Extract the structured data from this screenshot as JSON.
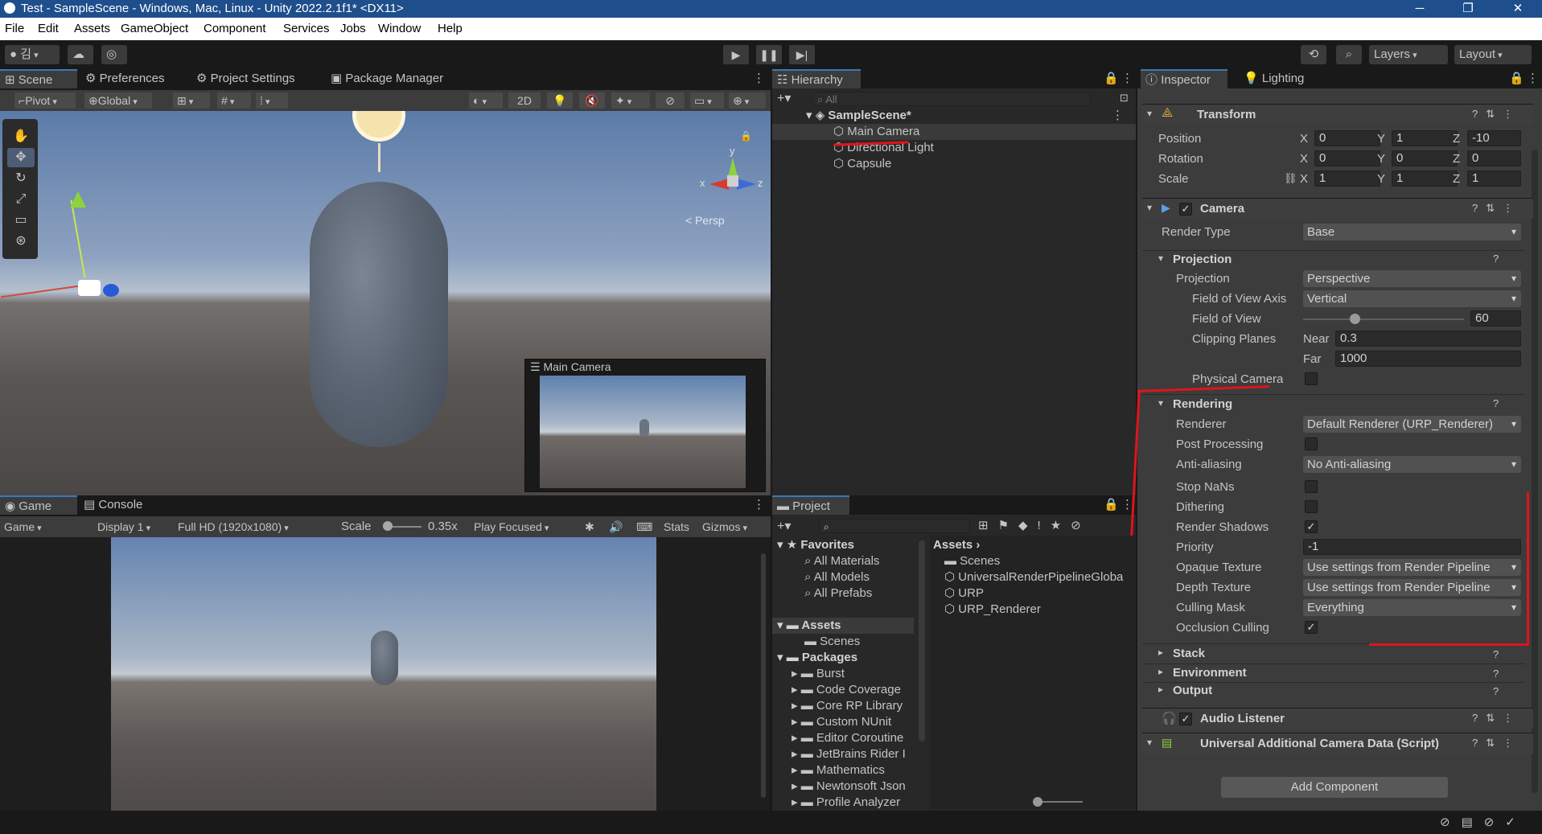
{
  "window": {
    "title": "Test - SampleScene - Windows, Mac, Linux - Unity 2022.2.1f1* <DX11>",
    "minimize": "─",
    "maximize": "❐",
    "close": "✕"
  },
  "menu": [
    "File",
    "Edit",
    "Assets",
    "GameObject",
    "Component",
    "Services",
    "Jobs",
    "Window",
    "Help"
  ],
  "toolbar": {
    "account": "김",
    "layers": "Layers",
    "layout": "Layout"
  },
  "scene_tabs": [
    "Scene",
    "Preferences",
    "Project Settings",
    "Package Manager"
  ],
  "scene_toolbar": {
    "pivot": "Pivot",
    "global": "Global",
    "mode2d": "2D"
  },
  "scene": {
    "persp": "< Persp",
    "gizmo_x": "x",
    "gizmo_y": "y",
    "gizmo_z": "z",
    "preview_title": "Main Camera"
  },
  "game_tabs": [
    "Game",
    "Console"
  ],
  "game_toolbar": {
    "mode": "Game",
    "display": "Display 1",
    "resolution": "Full HD (1920x1080)",
    "scale_label": "Scale",
    "scale_value": "0.35x",
    "play_focused": "Play Focused",
    "stats": "Stats",
    "gizmos": "Gizmos"
  },
  "hierarchy": {
    "tab": "Hierarchy",
    "search_placeholder": "All",
    "scene": "SampleScene*",
    "items": [
      "Main Camera",
      "Directional Light",
      "Capsule"
    ]
  },
  "project": {
    "tab": "Project",
    "favorites": "Favorites",
    "favorite_items": [
      "All Materials",
      "All Models",
      "All Prefabs"
    ],
    "assets": "Assets",
    "asset_children": [
      "Scenes"
    ],
    "packages": "Packages",
    "package_items": [
      "Burst",
      "Code Coverage",
      "Core RP Library",
      "Custom NUnit",
      "Editor Coroutine",
      "JetBrains Rider I",
      "Mathematics",
      "Newtonsoft Json",
      "Profile Analyzer"
    ],
    "breadcrumb": "Assets",
    "files": [
      "Scenes",
      "UniversalRenderPipelineGloba",
      "URP",
      "URP_Renderer"
    ]
  },
  "inspector": {
    "tabs": [
      "Inspector",
      "Lighting"
    ],
    "transform": {
      "title": "Transform",
      "rows": [
        {
          "label": "Position",
          "x": "0",
          "y": "1",
          "z": "-10"
        },
        {
          "label": "Rotation",
          "x": "0",
          "y": "0",
          "z": "0"
        },
        {
          "label": "Scale",
          "x": "1",
          "y": "1",
          "z": "1"
        }
      ]
    },
    "camera": {
      "title": "Camera",
      "render_type_label": "Render Type",
      "render_type": "Base",
      "projection_section": "Projection",
      "projection_label": "Projection",
      "projection": "Perspective",
      "fov_axis_label": "Field of View Axis",
      "fov_axis": "Vertical",
      "fov_label": "Field of View",
      "fov": "60",
      "fov_fraction": 0.32,
      "clipping_label": "Clipping Planes",
      "near_label": "Near",
      "near": "0.3",
      "far_label": "Far",
      "far": "1000",
      "physical_label": "Physical Camera",
      "rendering_section": "Rendering",
      "renderer_label": "Renderer",
      "renderer": "Default Renderer (URP_Renderer)",
      "post_label": "Post Processing",
      "aa_label": "Anti-aliasing",
      "aa": "No Anti-aliasing",
      "stopnans_label": "Stop NaNs",
      "dither_label": "Dithering",
      "shadows_label": "Render Shadows",
      "priority_label": "Priority",
      "priority": "-1",
      "opaque_label": "Opaque Texture",
      "opaque": "Use settings from Render Pipeline",
      "depth_label": "Depth Texture",
      "depth": "Use settings from Render Pipeline",
      "culling_label": "Culling Mask",
      "culling": "Everything",
      "occlusion_label": "Occlusion Culling",
      "stack": "Stack",
      "environment": "Environment",
      "output": "Output"
    },
    "audio": "Audio Listener",
    "additional": "Universal Additional Camera Data (Script)",
    "add_component": "Add Component",
    "axis_x": "X",
    "axis_y": "Y",
    "axis_z": "Z"
  },
  "colors": {
    "accent": "#3a79bb",
    "annotation": "#e0141a",
    "titlebar": "#1f4e8c"
  }
}
